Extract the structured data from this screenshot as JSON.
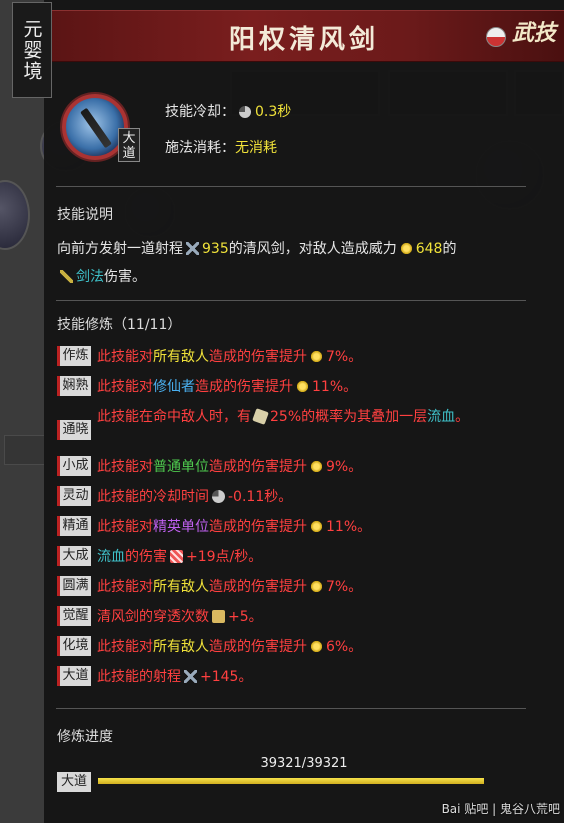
{
  "realm": "元婴境",
  "skill": {
    "name": "阳权清风剑",
    "category": "武技",
    "grade": "大道",
    "cooldown_label": "技能冷却：",
    "cooldown_value": "0.3秒",
    "cost_label": "施法消耗：",
    "cost_value": "无消耗"
  },
  "description": {
    "title": "技能说明",
    "text": {
      "p1": "向前方发射一道射程",
      "range": "935",
      "p2": "的清风剑，对敌人造成威力",
      "power": "648",
      "p3": "的",
      "element": "剑法",
      "p4": "伤害。"
    }
  },
  "refinement": {
    "title": "技能修炼（11/11）",
    "rows": [
      {
        "tag": "作炼",
        "a": "此技能对",
        "target": "所有敌人",
        "b": "造成的伤害提升",
        "value": "7%。"
      },
      {
        "tag": "娴熟",
        "a": "此技能对",
        "target": "修仙者",
        "b": "造成的伤害提升",
        "value": "11%。"
      },
      {
        "tag": "通晓",
        "a": "此技能在命中敌人时，有",
        "value": "25%的概率为其叠加一层",
        "effect": "流血",
        "end": "。"
      },
      {
        "tag": "小成",
        "a": "此技能对",
        "target": "普通单位",
        "b": "造成的伤害提升",
        "value": "9%。"
      },
      {
        "tag": "灵动",
        "a": "此技能的冷却时间",
        "value": "-0.11秒。"
      },
      {
        "tag": "精通",
        "a": "此技能对",
        "target": "精英单位",
        "b": "造成的伤害提升",
        "value": "11%。"
      },
      {
        "tag": "大成",
        "effect": "流血",
        "a": "的伤害",
        "value": "+19点/秒。"
      },
      {
        "tag": "圆满",
        "a": "此技能对",
        "target": "所有敌人",
        "b": "造成的伤害提升",
        "value": "7%。"
      },
      {
        "tag": "觉醒",
        "a": "清风剑的穿透次数",
        "value": "+5。"
      },
      {
        "tag": "化境",
        "a": "此技能对",
        "target": "所有敌人",
        "b": "造成的伤害提升",
        "value": "6%。"
      },
      {
        "tag": "大道",
        "a": "此技能的射程",
        "value": "+145。"
      }
    ]
  },
  "progress": {
    "title": "修炼进度",
    "value_text": "39321/39321",
    "fraction": 1.0,
    "tag": "大道"
  },
  "watermark": "Bai 贴吧 | 鬼谷八荒吧",
  "colors": {
    "title_bar": "#7a1e1e",
    "highlight_yellow": "#f0e23a",
    "refine_red": "#ff4040",
    "cyan": "#3fc0c8",
    "green": "#4ec94e",
    "blue": "#4ab0f0",
    "purple": "#c060f0"
  }
}
